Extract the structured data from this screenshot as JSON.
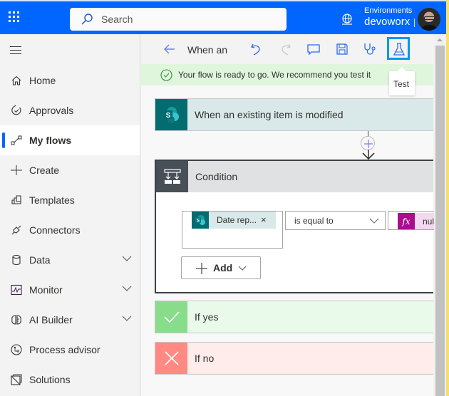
{
  "topbar": {
    "search_placeholder": "Search",
    "environment_label": "Environments",
    "environment_name": "devoworx",
    "brand_color": "#0066ff"
  },
  "sidebar": {
    "items": [
      {
        "label": "Home",
        "icon": "home-icon",
        "active": false,
        "expandable": false
      },
      {
        "label": "Approvals",
        "icon": "approvals-icon",
        "active": false,
        "expandable": false
      },
      {
        "label": "My flows",
        "icon": "flows-icon",
        "active": true,
        "expandable": false
      },
      {
        "label": "Create",
        "icon": "plus-icon",
        "active": false,
        "expandable": false
      },
      {
        "label": "Templates",
        "icon": "templates-icon",
        "active": false,
        "expandable": false
      },
      {
        "label": "Connectors",
        "icon": "connectors-icon",
        "active": false,
        "expandable": false
      },
      {
        "label": "Data",
        "icon": "database-icon",
        "active": false,
        "expandable": true
      },
      {
        "label": "Monitor",
        "icon": "monitor-icon",
        "active": false,
        "expandable": true
      },
      {
        "label": "AI Builder",
        "icon": "brain-icon",
        "active": false,
        "expandable": true
      },
      {
        "label": "Process advisor",
        "icon": "process-advisor-icon",
        "active": false,
        "expandable": false
      },
      {
        "label": "Solutions",
        "icon": "solutions-icon",
        "active": false,
        "expandable": false
      }
    ]
  },
  "toolbar": {
    "flow_title": "When an",
    "tooltip": "Test",
    "icons": [
      "back-arrow-icon",
      "undo-icon",
      "redo-icon",
      "comment-icon",
      "save-icon",
      "flow-checker-icon",
      "test-flask-icon"
    ]
  },
  "banner": {
    "message": "Your flow is ready to go. We recommend you test it"
  },
  "flow": {
    "trigger": {
      "label": "When an existing item is modified",
      "icon": "sharepoint-icon"
    },
    "condition": {
      "label": "Condition",
      "left_token": "Date rep...",
      "operator": "is equal to",
      "right_token": "nul",
      "add_label": "Add"
    },
    "if_yes": {
      "label": "If yes"
    },
    "if_no": {
      "label": "If no"
    }
  }
}
